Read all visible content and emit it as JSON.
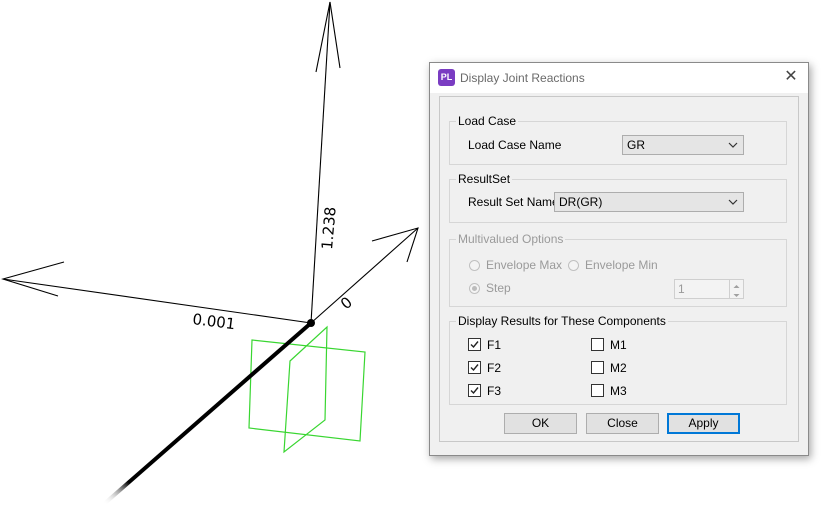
{
  "viewport": {
    "labels": {
      "y_value": "1.238",
      "x_value": "0.001",
      "z_value": "0"
    },
    "colors": {
      "support": "#39d631",
      "axis": "#000000"
    }
  },
  "dialog": {
    "icon_text": "PL",
    "icon_name": "pl-app-icon",
    "title": "Display Joint Reactions",
    "close_glyph": "✕",
    "load_case": {
      "group_title": "Load Case",
      "name_label": "Load Case Name",
      "selected": "GR"
    },
    "result_set": {
      "group_title": "ResultSet",
      "name_label": "Result Set Name",
      "selected": "DR(GR)"
    },
    "multivalued": {
      "group_title": "Multivalued Options",
      "envelope_max": "Envelope Max",
      "envelope_min": "Envelope Min",
      "step": "Step",
      "step_value": "1",
      "selected_option": "Step",
      "enabled": false
    },
    "components": {
      "group_title": "Display Results for These Components",
      "items": [
        {
          "label": "F1",
          "checked": true
        },
        {
          "label": "F2",
          "checked": true
        },
        {
          "label": "F3",
          "checked": true
        },
        {
          "label": "M1",
          "checked": false
        },
        {
          "label": "M2",
          "checked": false
        },
        {
          "label": "M3",
          "checked": false
        }
      ]
    },
    "buttons": {
      "ok": "OK",
      "close": "Close",
      "apply": "Apply"
    },
    "accent_color": "#0078d7",
    "icon_color": "#7a3cc2"
  }
}
